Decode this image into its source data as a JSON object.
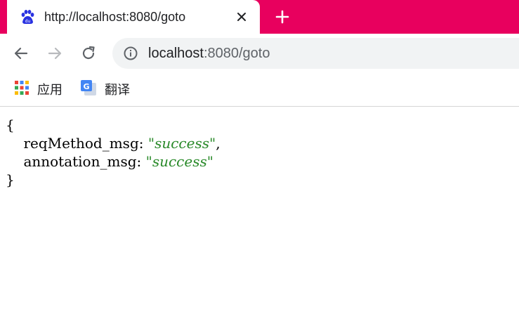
{
  "tab": {
    "title": "http://localhost:8080/goto",
    "favicon": "baidu-paw-icon",
    "close_icon": "close-icon"
  },
  "new_tab_icon": "plus-icon",
  "toolbar": {
    "back_icon": "arrow-left-icon",
    "forward_icon": "arrow-right-icon",
    "reload_icon": "reload-icon",
    "url_host": "localhost",
    "url_path": ":8080/goto",
    "info_icon": "info-icon"
  },
  "bookmarks": [
    {
      "label": "应用",
      "icon": "apps-grid-icon"
    },
    {
      "label": "翻译",
      "icon": "google-translate-icon"
    }
  ],
  "json_body": {
    "open_brace": "{",
    "close_brace": "}",
    "entries": [
      {
        "key": "reqMethod_msg",
        "value": "success"
      },
      {
        "key": "annotation_msg",
        "value": "success"
      }
    ]
  },
  "colors": {
    "tab_strip": "#e8005e",
    "string_value": "#2a8a2a",
    "omnibox_bg": "#f1f3f4"
  }
}
